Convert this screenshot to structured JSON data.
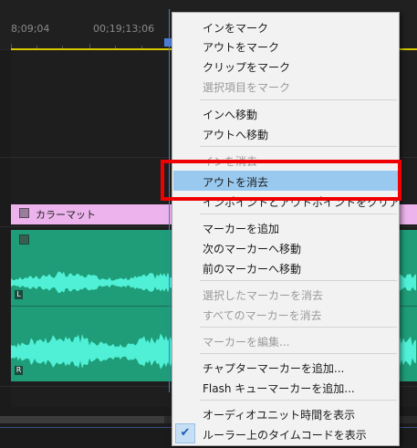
{
  "ruler": {
    "timecodes": [
      "8;09;04",
      "00;19;13;06"
    ]
  },
  "clips": {
    "color_matte_name": "カラーマット",
    "audio_channels": [
      "L",
      "R"
    ]
  },
  "menu": {
    "items": [
      {
        "label": "インをマーク",
        "enabled": true
      },
      {
        "label": "アウトをマーク",
        "enabled": true
      },
      {
        "label": "クリップをマーク",
        "enabled": true
      },
      {
        "label": "選択項目をマーク",
        "enabled": false
      },
      {
        "label": "インへ移動",
        "enabled": true
      },
      {
        "label": "アウトへ移動",
        "enabled": true
      },
      {
        "label": "インを消去",
        "enabled": false
      },
      {
        "label": "アウトを消去",
        "enabled": true,
        "hovered": true
      },
      {
        "label": "インポイントとアウトポイントをクリア",
        "enabled": true
      },
      {
        "label": "マーカーを追加",
        "enabled": true
      },
      {
        "label": "次のマーカーへ移動",
        "enabled": true
      },
      {
        "label": "前のマーカーへ移動",
        "enabled": true
      },
      {
        "label": "選択したマーカーを消去",
        "enabled": false
      },
      {
        "label": "すべてのマーカーを消去",
        "enabled": false
      },
      {
        "label": "マーカーを編集...",
        "enabled": false
      },
      {
        "label": "チャプターマーカーを追加...",
        "enabled": true
      },
      {
        "label": "Flash キューマーカーを追加...",
        "enabled": true
      },
      {
        "label": "オーディオユニット時間を表示",
        "enabled": true
      },
      {
        "label": "ルーラー上のタイムコードを表示",
        "enabled": true,
        "checked": true
      }
    ],
    "check_glyph": "✔"
  },
  "colors": {
    "highlight_border": "#f00000",
    "hover_bg": "#99c9ef",
    "audio_clip": "#1f9c78",
    "waveform": "#4ff0d6",
    "color_matte": "#ecb3ec",
    "playhead": "#4b7dd6"
  }
}
